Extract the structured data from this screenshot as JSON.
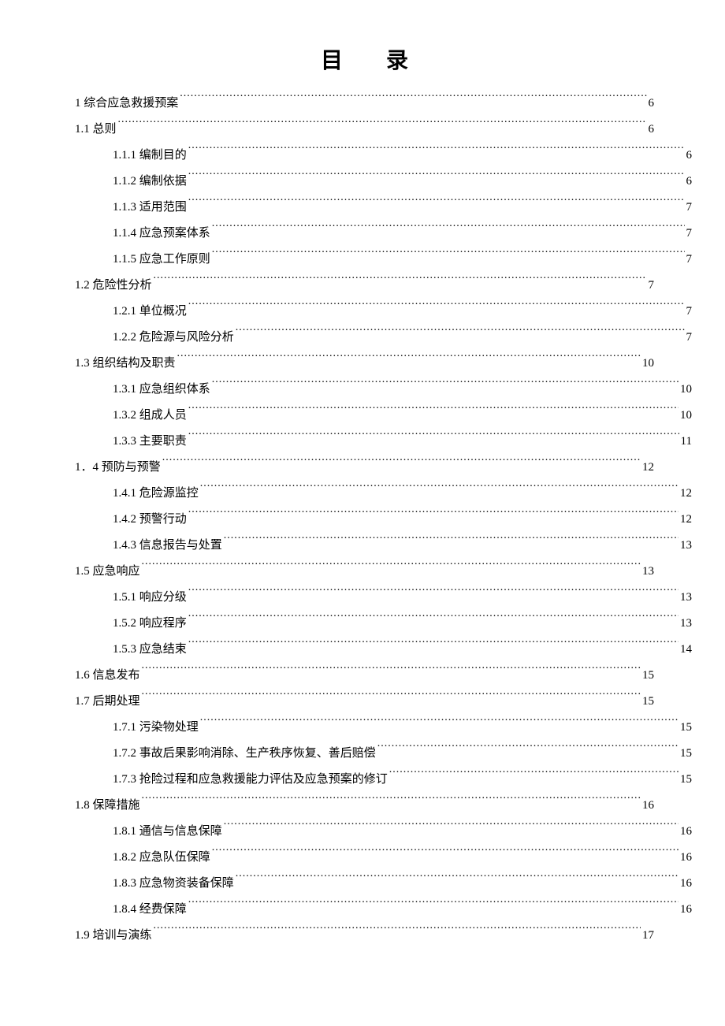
{
  "title": "目 录",
  "toc": [
    {
      "level": 1,
      "label": "1  综合应急救援预案",
      "page": "6"
    },
    {
      "level": 2,
      "label": "1.1 总则",
      "page": "6"
    },
    {
      "level": 3,
      "label": "1.1.1 编制目的",
      "page": "6"
    },
    {
      "level": 3,
      "label": "1.1.2 编制依据",
      "page": "6"
    },
    {
      "level": 3,
      "label": "1.1.3 适用范围",
      "page": "7"
    },
    {
      "level": 3,
      "label": "1.1.4 应急预案体系",
      "page": "7"
    },
    {
      "level": 3,
      "label": "1.1.5 应急工作原则",
      "page": "7"
    },
    {
      "level": 2,
      "label": "1.2 危险性分析",
      "page": "7"
    },
    {
      "level": 3,
      "label": "1.2.1 单位概况",
      "page": "7"
    },
    {
      "level": 3,
      "label": "1.2.2 危险源与风险分析",
      "page": "7"
    },
    {
      "level": 2,
      "label": "1.3 组织结构及职责",
      "page": "10"
    },
    {
      "level": 3,
      "label": "1.3.1 应急组织体系",
      "page": "10"
    },
    {
      "level": 3,
      "label": "1.3.2 组成人员",
      "page": "10"
    },
    {
      "level": 3,
      "label": "1.3.3 主要职责",
      "page": "11"
    },
    {
      "level": 2,
      "label": "1．4 预防与预警",
      "page": "12"
    },
    {
      "level": 3,
      "label": "1.4.1 危险源监控",
      "page": "12"
    },
    {
      "level": 3,
      "label": "1.4.2 预警行动",
      "page": "12"
    },
    {
      "level": 3,
      "label": "1.4.3 信息报告与处置",
      "page": "13"
    },
    {
      "level": 2,
      "label": "1.5 应急响应",
      "page": "13"
    },
    {
      "level": 3,
      "label": "1.5.1 响应分级",
      "page": "13"
    },
    {
      "level": 3,
      "label": "1.5.2 响应程序",
      "page": "13"
    },
    {
      "level": 3,
      "label": "1.5.3 应急结束",
      "page": "14"
    },
    {
      "level": 2,
      "label": "1.6 信息发布",
      "page": "15"
    },
    {
      "level": 2,
      "label": "1.7 后期处理",
      "page": "15"
    },
    {
      "level": 3,
      "label": "1.7.1 污染物处理",
      "page": "15"
    },
    {
      "level": 3,
      "label": "1.7.2 事故后果影响消除、生产秩序恢复、善后赔偿",
      "page": "15"
    },
    {
      "level": 3,
      "label": "1.7.3 抢险过程和应急救援能力评估及应急预案的修订",
      "page": "15"
    },
    {
      "level": 2,
      "label": "1.8 保障措施",
      "page": "16"
    },
    {
      "level": 3,
      "label": "1.8.1 通信与信息保障",
      "page": "16"
    },
    {
      "level": 3,
      "label": "1.8.2 应急队伍保障",
      "page": "16"
    },
    {
      "level": 3,
      "label": "1.8.3 应急物资装备保障",
      "page": "16"
    },
    {
      "level": 3,
      "label": "1.8.4 经费保障",
      "page": "16"
    },
    {
      "level": 2,
      "label": "1.9 培训与演练",
      "page": "17"
    }
  ]
}
